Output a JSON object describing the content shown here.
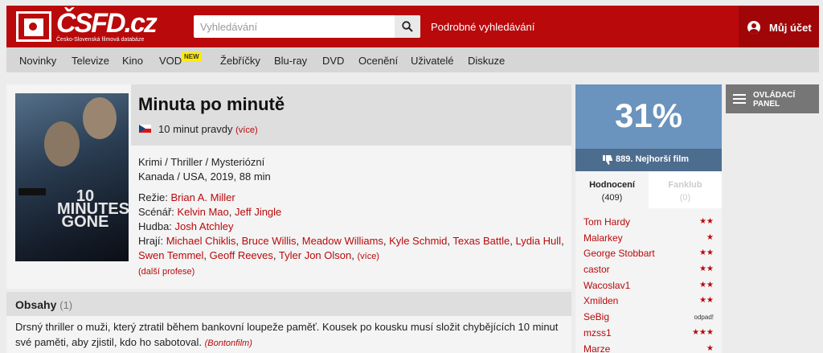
{
  "header": {
    "logo_text": "ČSFD.cz",
    "logo_subtitle": "Česko-Slovenská filmová databáze",
    "search_placeholder": "Vyhledávání",
    "advanced_search": "Podrobné vyhledávání",
    "account_label": "Můj účet"
  },
  "nav": {
    "items": [
      "Novinky",
      "Televize",
      "Kino",
      "VOD",
      "Žebříčky",
      "Blu-ray",
      "DVD",
      "Ocenění",
      "Uživatelé",
      "Diskuze"
    ],
    "vod_badge": "NEW"
  },
  "film": {
    "title": "Minuta po minutě",
    "alt_title": "10 minut pravdy",
    "alt_title_more": "(více)",
    "genres": "Krimi / Thriller / Mysteriózní",
    "origin": "Kanada / USA, 2019, 88 min",
    "poster_text": "10 MINUTES GONE",
    "credits": {
      "director_label": "Režie:",
      "director": "Brian A. Miller",
      "writers_label": "Scénář:",
      "writers": [
        "Kelvin Mao",
        "Jeff Jingle"
      ],
      "music_label": "Hudba:",
      "music": "Josh Atchley",
      "cast_label": "Hrají:",
      "cast": [
        "Michael Chiklis",
        "Bruce Willis",
        "Meadow Williams",
        "Kyle Schmid",
        "Texas Battle",
        "Lydia Hull",
        "Swen Temmel",
        "Geoff Reeves",
        "Tyler Jon Olson"
      ],
      "cast_more": "(více)"
    },
    "more_professions": "(další profese)"
  },
  "plot": {
    "title": "Obsahy",
    "count": "(1)",
    "text": "Drsný thriller o muži, který ztratil během bankovní loupeže paměť. Kousek po kousku musí složit chybějících 10 minut své paměti, aby zjistil, kdo ho sabotoval.",
    "source": "(Bontonfilm)"
  },
  "rating": {
    "value": "31%",
    "rank": "889. Nejhorší film",
    "tabs": [
      {
        "label": "Hodnocení",
        "count": "(409)"
      },
      {
        "label": "Fanklub",
        "count": "(0)"
      }
    ],
    "reviews": [
      {
        "user": "Tom Hardy",
        "stars": "★★"
      },
      {
        "user": "Malarkey",
        "stars": "★"
      },
      {
        "user": "George Stobbart",
        "stars": "★★"
      },
      {
        "user": "castor",
        "stars": "★★"
      },
      {
        "user": "Wacoslav1",
        "stars": "★★"
      },
      {
        "user": "Xmilden",
        "stars": "★★"
      },
      {
        "user": "SeBig",
        "stars": "odpad!"
      },
      {
        "user": "mzss1",
        "stars": "★★★"
      },
      {
        "user": "Marze",
        "stars": "★"
      }
    ]
  },
  "control_panel": {
    "label": "OVLÁDACÍ PANEL"
  },
  "colors": {
    "brand_red": "#b9090b",
    "rating_blue": "#6a93bd",
    "rank_blue": "#4d6d8e"
  }
}
